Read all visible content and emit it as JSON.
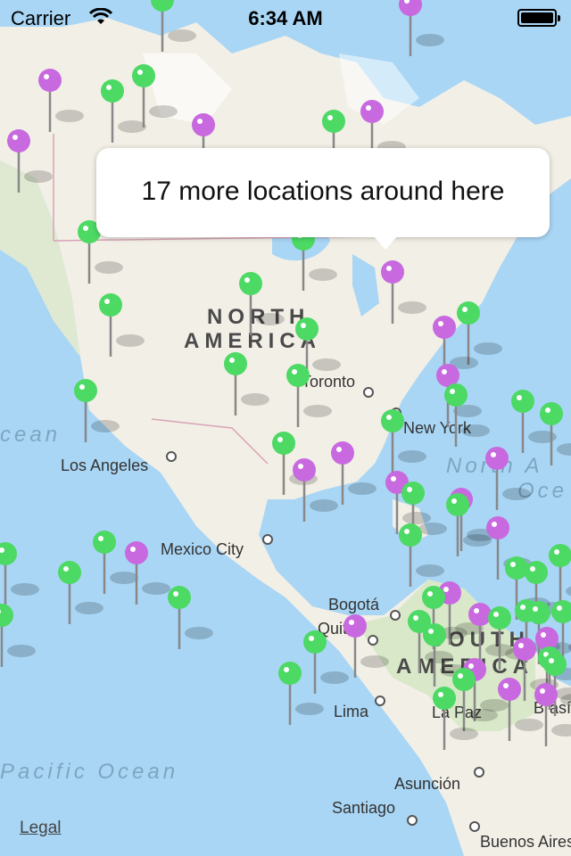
{
  "status_bar": {
    "carrier": "Carrier",
    "time": "6:34 AM"
  },
  "callout": {
    "text": "17 more locations around here"
  },
  "map_labels": {
    "continents": [
      "NORTH",
      "AMERICA",
      "SOUTH",
      "AMERICA"
    ],
    "oceans": [
      "cean",
      "North A",
      "Oce",
      "Pacific Ocean"
    ],
    "cities": [
      "Toronto",
      "New York",
      "Los Angeles",
      "Mexico City",
      "Bogotá",
      "Quito",
      "Lima",
      "La Paz",
      "Brasília",
      "Asunción",
      "Santiago",
      "Buenos Aires"
    ]
  },
  "legal_link": "Legal",
  "colors": {
    "water": "#a9d6f5",
    "land": "#f2efe6",
    "pin_green": "#4cd964",
    "pin_purple": "#c869e0"
  },
  "icons": {
    "wifi": "wifi-icon",
    "battery": "battery-icon",
    "map_pin": "map-pin-icon"
  }
}
